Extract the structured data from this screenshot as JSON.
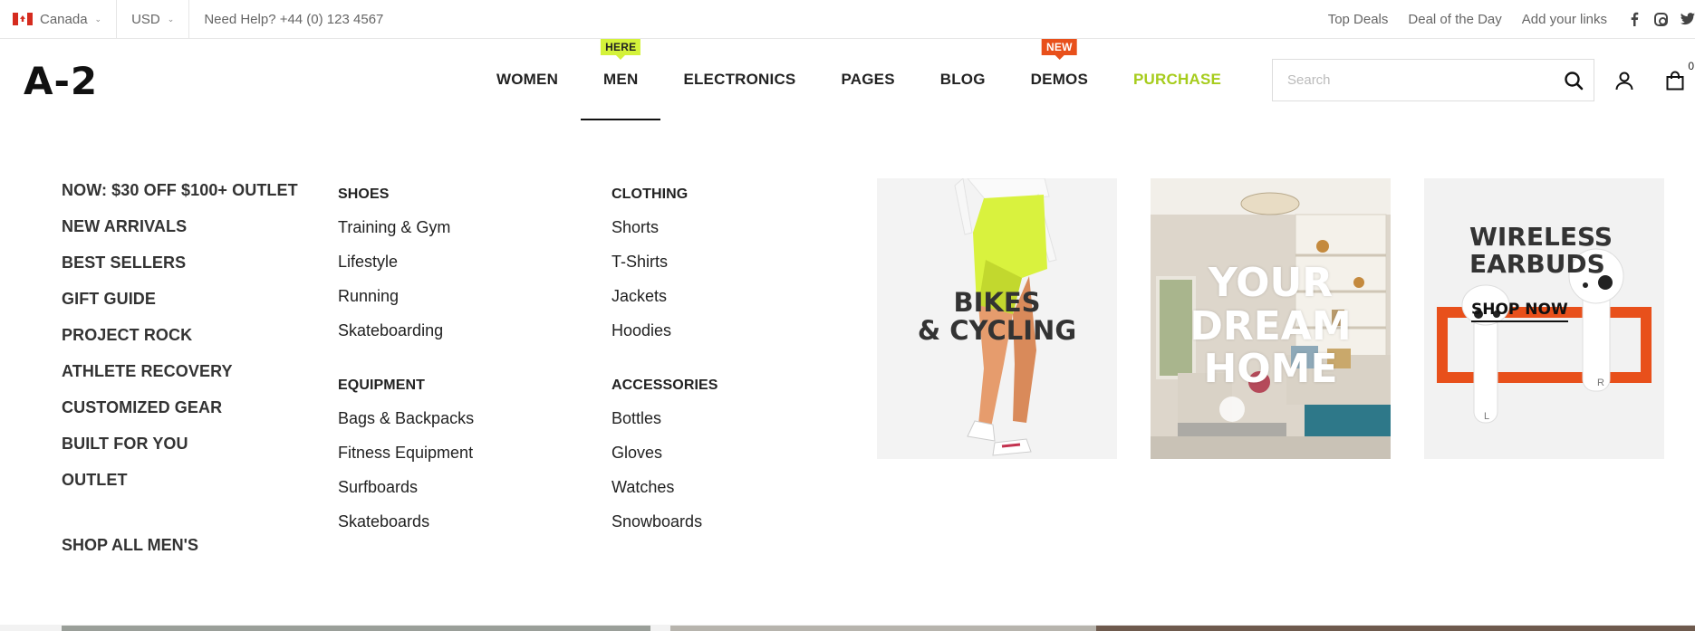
{
  "topbar": {
    "country": "Canada",
    "currency": "USD",
    "help": "Need Help? +44 (0) 123 4567",
    "links": [
      "Top Deals",
      "Deal of the Day",
      "Add your links"
    ]
  },
  "header": {
    "logo": "A-2",
    "nav": [
      {
        "label": "WOMEN"
      },
      {
        "label": "MEN",
        "badge": "HERE"
      },
      {
        "label": "ELECTRONICS"
      },
      {
        "label": "PAGES"
      },
      {
        "label": "BLOG"
      },
      {
        "label": "DEMOS",
        "badge": "NEW"
      },
      {
        "label": "PURCHASE"
      }
    ],
    "search_placeholder": "Search",
    "cart_count": "0"
  },
  "mega": {
    "featured": [
      "NOW: $30 OFF $100+ OUTLET",
      "NEW ARRIVALS",
      "BEST SELLERS",
      "GIFT GUIDE",
      "PROJECT ROCK",
      "ATHLETE RECOVERY",
      "CUSTOMIZED GEAR",
      "BUILT FOR YOU",
      "OUTLET"
    ],
    "shop_all": "SHOP ALL MEN'S",
    "groups": [
      {
        "title": "SHOES",
        "items": [
          "Training & Gym",
          "Lifestyle",
          "Running",
          "Skateboarding"
        ]
      },
      {
        "title": "EQUIPMENT",
        "items": [
          "Bags & Backpacks",
          "Fitness Equipment",
          "Surfboards",
          "Skateboards"
        ]
      },
      {
        "title": "CLOTHING",
        "items": [
          "Shorts",
          "T-Shirts",
          "Jackets",
          "Hoodies"
        ]
      },
      {
        "title": "ACCESSORIES",
        "items": [
          "Bottles",
          "Gloves",
          "Watches",
          "Snowboards"
        ]
      }
    ],
    "promos": [
      {
        "line1": "BIKES",
        "line2": "& CYCLING"
      },
      {
        "line1": "YOUR",
        "line2": "DREAM",
        "line3": "HOME"
      },
      {
        "line1": "WIRELESS",
        "line2": "EARBUDS",
        "cta": "SHOP NOW",
        "left": "L",
        "right": "R"
      }
    ]
  },
  "colors": {
    "accent_green": "#a6cc1c",
    "badge_here": "#d4f23a",
    "badge_new": "#e8501b"
  }
}
